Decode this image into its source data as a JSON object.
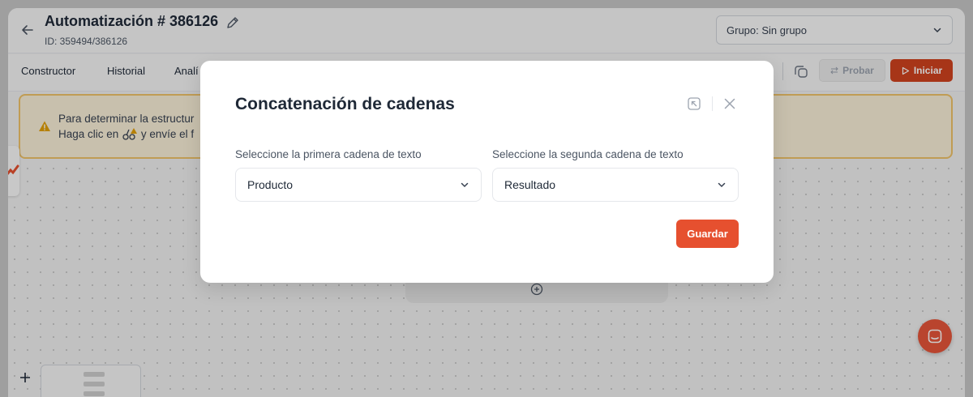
{
  "header": {
    "title": "Automatización # 386126",
    "subtitle": "ID: 359494/386126",
    "group_select": "Grupo: Sin grupo"
  },
  "tabs": [
    {
      "label": "Constructor"
    },
    {
      "label": "Historial"
    },
    {
      "label": "Analí"
    }
  ],
  "toolbar": {
    "test_label": "Probar",
    "start_label": "Iniciar"
  },
  "alert": {
    "line1": "Para determinar la estructur",
    "line2_prefix": "Haga clic en",
    "line2_suffix": "y envíe el f"
  },
  "modal": {
    "title": "Concatenación de cadenas",
    "first_label": "Seleccione la primera cadena de texto",
    "first_value": "Producto",
    "second_label": "Seleccione la segunda cadena de texto",
    "second_value": "Resultado",
    "save_label": "Guardar"
  },
  "colors": {
    "accent": "#e6502f",
    "start_button": "#d1431f",
    "alert_bg": "#fbf0d9",
    "alert_border": "#f0c36a",
    "chat_button": "#e8563a"
  },
  "icons": [
    "back-arrow-icon",
    "pencil-icon",
    "chevron-down-icon",
    "copy-icon",
    "swap-icon",
    "play-icon",
    "warning-icon",
    "webhook-icon",
    "expand-icon",
    "close-icon",
    "plus-icon",
    "chat-icon",
    "plus-circle-icon"
  ]
}
